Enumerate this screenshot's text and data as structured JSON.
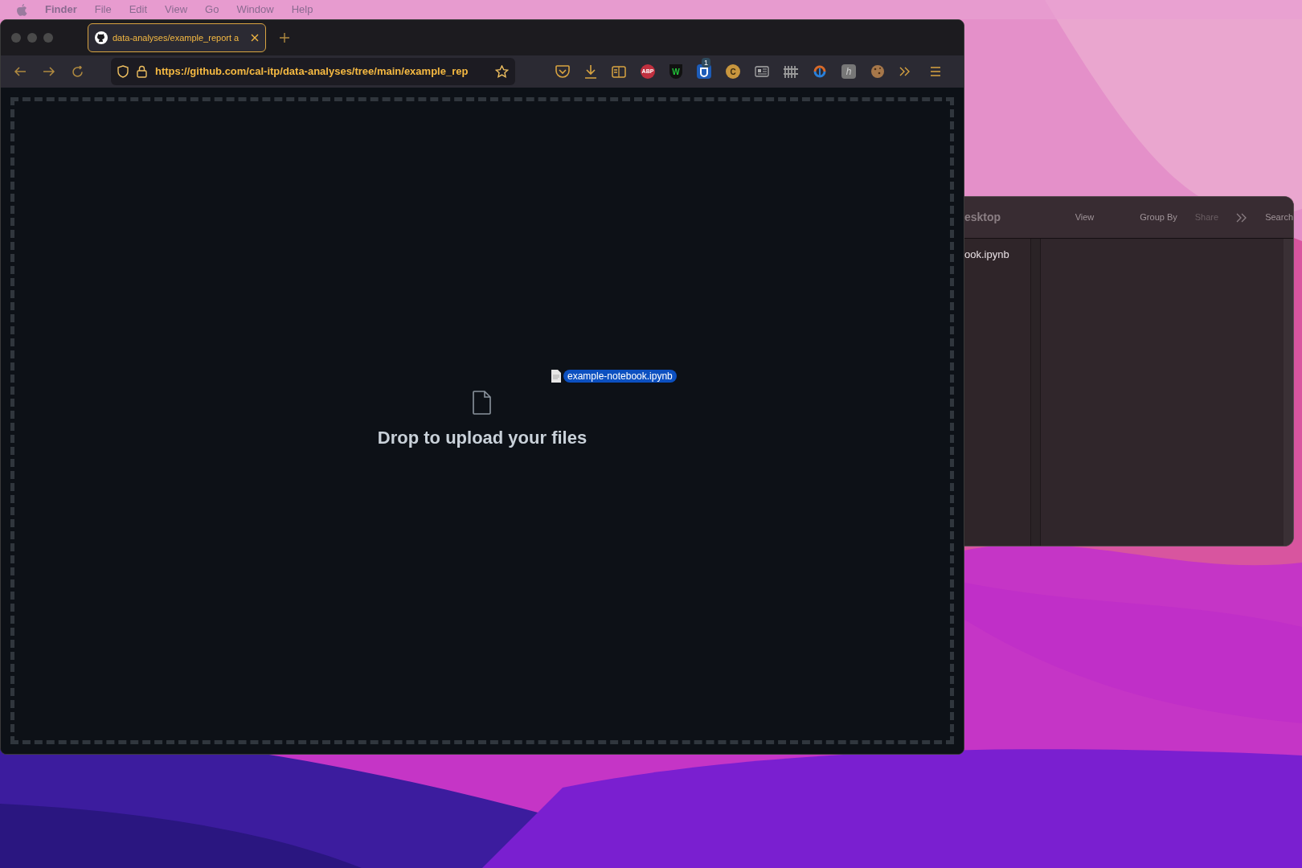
{
  "menu_bar": {
    "app": "Finder",
    "items": [
      "File",
      "Edit",
      "View",
      "Go",
      "Window",
      "Help"
    ]
  },
  "browser": {
    "tabs": [
      {
        "title": "data-analyses/example_report a",
        "selected": true
      }
    ],
    "url": "https://github.com/cal-itp/data-analyses/tree/main/example_rep",
    "extensions": [
      {
        "kind": "pocket"
      },
      {
        "kind": "download"
      },
      {
        "kind": "sidebar"
      },
      {
        "kind": "abp",
        "label": "ABP"
      },
      {
        "kind": "shield",
        "label": "W"
      },
      {
        "kind": "vault",
        "label": "1"
      },
      {
        "kind": "coin",
        "label": "C"
      },
      {
        "kind": "news"
      },
      {
        "kind": "fence"
      },
      {
        "kind": "sync"
      },
      {
        "kind": "tile",
        "label": "h"
      },
      {
        "kind": "cookie"
      }
    ],
    "drop_zone": {
      "message": "Drop to upload your files"
    },
    "dragged_file": {
      "name": "example-notebook.ipynb"
    }
  },
  "finder": {
    "title": "esktop",
    "toolbar": [
      {
        "label": "View",
        "disabled": false
      },
      {
        "label": "Group By",
        "disabled": false
      },
      {
        "label": "Share",
        "disabled": true
      },
      {
        "label": "Search",
        "disabled": false
      }
    ],
    "files": [
      {
        "name": "ook.ipynb"
      }
    ]
  }
}
